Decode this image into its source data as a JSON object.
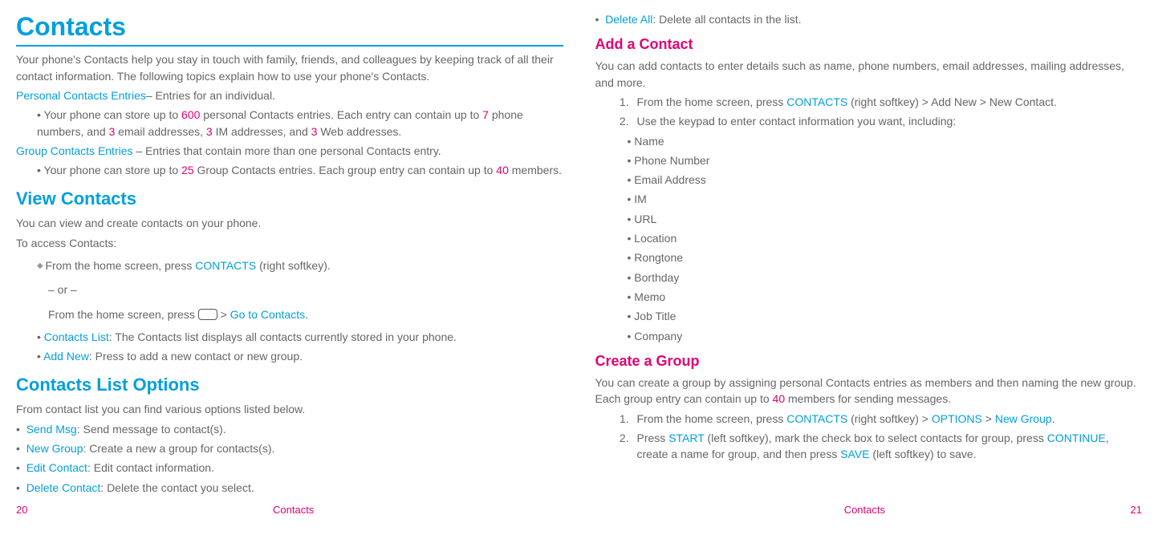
{
  "left": {
    "title": "Contacts",
    "intro": "Your phone's Contacts help you stay in touch with family, friends, and colleagues by keeping track of all their contact information. The following topics explain how to use your phone's Contacts.",
    "pce_label": "Personal Contacts Entries",
    "pce_tail": "– Entries for an individual.",
    "pce_b_pre": "Your phone can store up to ",
    "n600": "600",
    "pce_b_mid1": " personal Contacts entries. Each entry can contain up to ",
    "n7": "7",
    "pce_b_mid2": " phone numbers, and ",
    "n3a": "3",
    "pce_b_mid3": " email addresses, ",
    "n3b": "3",
    "pce_b_mid4": " IM addresses, and ",
    "n3c": "3",
    "pce_b_mid5": " Web addresses.",
    "gce_label": "Group Contacts Entries",
    "gce_tail": " – Entries that contain more than one personal Contacts entry.",
    "gce_b_pre": "Your phone can store up to ",
    "n25": "25",
    "gce_b_mid": " Group Contacts entries. Each group entry can contain up to ",
    "n40": "40",
    "gce_b_tail": " members.",
    "h2_view": "View Contacts",
    "view_p1": "You can view and create contacts on your phone.",
    "view_p2": "To access Contacts:",
    "view_step_pre": "From the home screen, press ",
    "contacts_kw": "CONTACTS",
    "view_step_tail": " (right softkey).",
    "or": "– or –",
    "view_alt_pre": "From the home screen, press ",
    "gt": " > ",
    "goto": "Go to Contacts",
    "period": ".",
    "cl_label": "Contacts List",
    "cl_tail": ": The Contacts list displays all contacts currently stored in your phone.",
    "an_label": "Add New",
    "an_tail": ": Press to add a new contact or new group.",
    "h2_clo": "Contacts List Options",
    "clo_intro": "From contact list you can find various options listed below.",
    "opt1_l": "Send Msg",
    "opt1_t": ": Send message to contact(s).",
    "opt2_l": "New Group",
    "opt2_t": ": Create a new a group for contacts(s).",
    "opt3_l": "Edit Contact",
    "opt3_t": ": Edit contact information.",
    "opt4_l": "Delete Contact",
    "opt4_t": ": Delete the contact you select."
  },
  "right": {
    "opt5_l": "Delete All",
    "opt5_t": ": Delete all contacts in the list.",
    "h3_add": "Add a Contact",
    "add_intro": "You can add contacts to enter details such as name, phone numbers, email addresses, mailing addresses, and more.",
    "add_s1_pre": "From the home screen, press ",
    "add_s1_kw": "CONTACTS",
    "add_s1_tail": " (right softkey) > Add New > New Contact.",
    "add_s2": "Use the keypad to enter contact information you want, including:",
    "fields": [
      "Name",
      "Phone Number",
      "Email Address",
      "IM",
      "URL",
      "Location",
      "Rongtone",
      "Borthday",
      "Memo",
      "Job Title",
      "Company"
    ],
    "h3_grp": "Create a Group",
    "grp_intro_pre": "You can create a group by assigning personal Contacts entries as members and then naming the new group. Each group entry can contain up to ",
    "grp_40": "40",
    "grp_intro_tail": " members for sending messages.",
    "grp_s1_pre": "From the home screen, press ",
    "grp_s1_c": "CONTACTS",
    "grp_s1_mid": " (right softkey) > ",
    "grp_s1_o": "OPTIONS",
    "grp_s1_gt": " > ",
    "grp_s1_ng": "New Group",
    "grp_s2_a": "Press ",
    "grp_s2_start": "START",
    "grp_s2_b": " (left softkey), mark the check box to select contacts for group, press ",
    "grp_s2_cont": "CONTINUE",
    "grp_s2_c": ", create a name for group, and then press ",
    "grp_s2_save": "SAVE",
    "grp_s2_d": " (left softkey) to save."
  },
  "footer": {
    "p20": "20",
    "label": "Contacts",
    "p21": "21"
  }
}
